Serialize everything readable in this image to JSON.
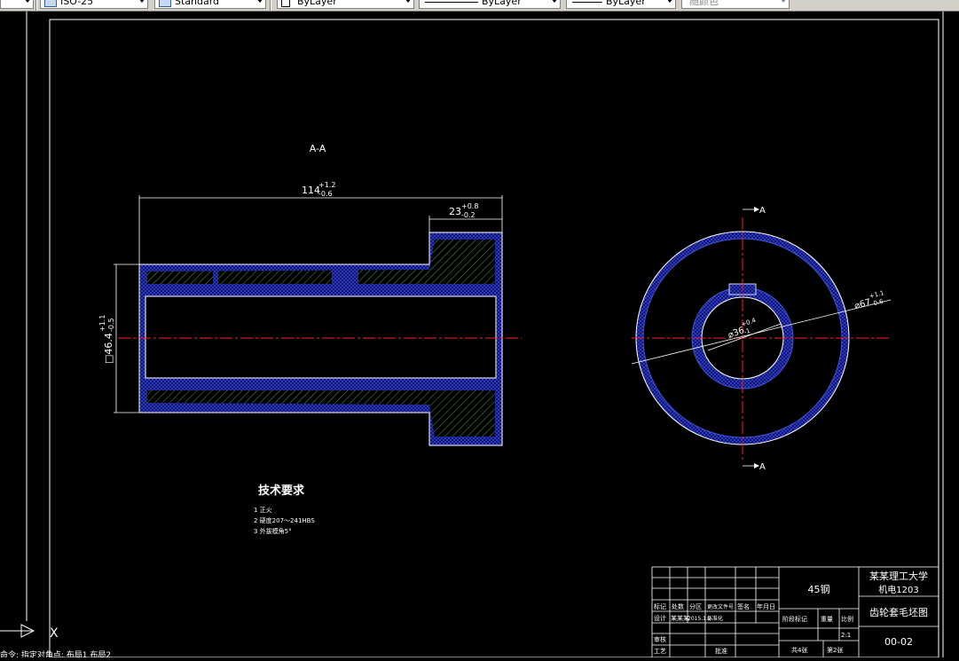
{
  "toolbar": {
    "dimstyle_value": "ISO-25",
    "tablestyle_value": "Standard",
    "layer_value": "ByLayer",
    "linetype_value": "ByLayer",
    "lineweight_value": "ByLayer",
    "plotstyle_value": "随颜色"
  },
  "drawing": {
    "section_label": "A-A",
    "dims": {
      "length_main": "114",
      "length_tol_upper": "+1.2",
      "length_tol_lower": "-0.6",
      "step_main": "23",
      "step_tol_upper": "+0.8",
      "step_tol_lower": "-0.2",
      "bore_main": "□46.4",
      "bore_tol_upper": "+1.1",
      "bore_tol_lower": "-0.5",
      "inner_dia": "⌀36",
      "inner_tol_upper": "+0.4",
      "inner_tol_lower": "-1",
      "outer_dia": "⌀67",
      "outer_tol_upper": "+1.1",
      "outer_tol_lower": "-0.6"
    },
    "cut_top": "A",
    "cut_bottom": "A",
    "notes_title": "技术要求",
    "notes": [
      "1  正火",
      "2  硬度207～241HBS",
      "3  外拔模角5°"
    ]
  },
  "title_block": {
    "material": "45钢",
    "school": "某某理工大学",
    "class_name": "机电1203",
    "drawing_name": "齿轮套毛坯图",
    "drawing_no": "00-02",
    "h_mark": "标记",
    "h_count": "处数",
    "h_zone": "分区",
    "h_docno": "更改文件号",
    "h_sign": "签名",
    "h_date": "年月日",
    "designer_label": "设计",
    "designer_name": "某某某",
    "design_date": "2015.1.2",
    "std_label": "标准化",
    "review_label": "审核",
    "craft_label": "工艺",
    "approve_label": "批准",
    "stage_label": "阶段标记",
    "weight_label": "重量",
    "scale_label": "比例",
    "scale_value": "2:1",
    "sheets_total": "共4张",
    "sheet_no": "第2张"
  },
  "ucs": {
    "x_label": "X"
  },
  "command_line": "命令: 指定对角点: 布局1 布局2"
}
